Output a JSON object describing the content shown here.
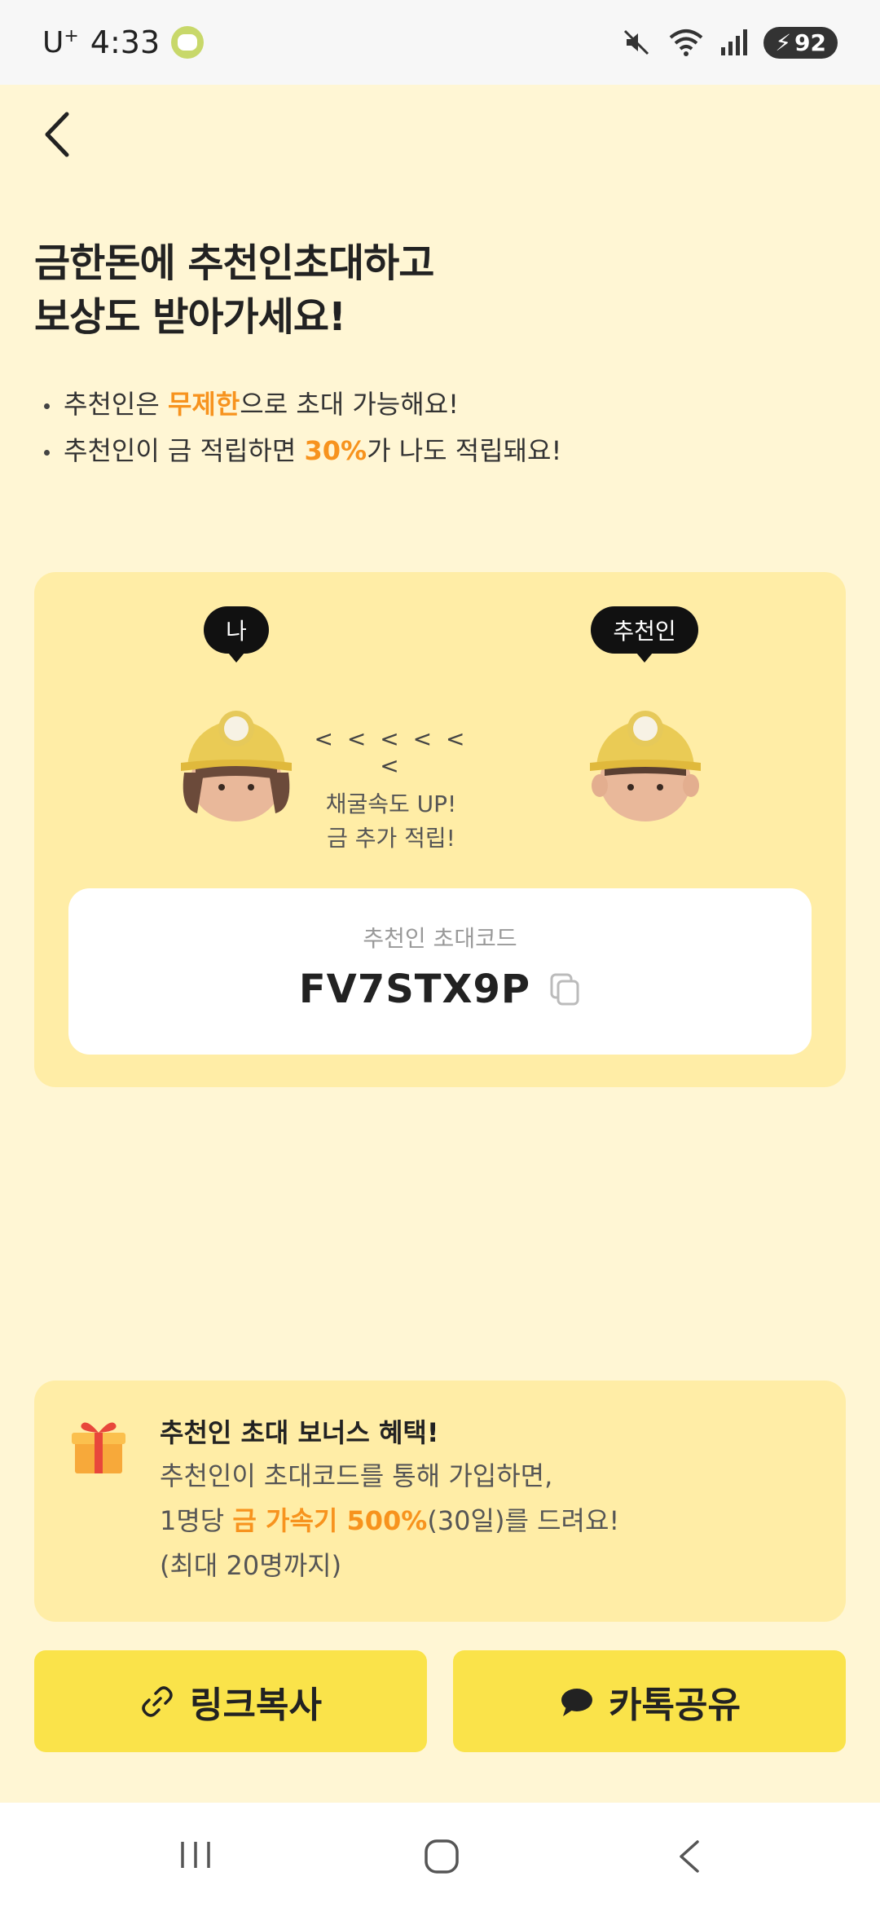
{
  "status_bar": {
    "carrier": "U",
    "carrier_sup": "+",
    "time": "4:33",
    "battery": "92"
  },
  "header": {
    "title_line1": "금한돈에 추천인초대하고",
    "title_line2": "보상도 받아가세요!"
  },
  "bullets": [
    {
      "pre": "추천인은 ",
      "highlight": "무제한",
      "post": "으로 초대 가능해요!"
    },
    {
      "pre": "추천인이 금 적립하면 ",
      "highlight": "30%",
      "post": "가 나도 적립돼요!"
    }
  ],
  "invite_card": {
    "me_label": "나",
    "referrer_label": "추천인",
    "arrows": "< < < < < <",
    "middle_line1": "채굴속도 UP!",
    "middle_line2": "금 추가 적립!",
    "code_label": "추천인 초대코드",
    "code_value": "FV7STX9P"
  },
  "bonus": {
    "title": "추천인 초대 보너스 혜택!",
    "line1": "추천인이 초대코드를 통해 가입하면,",
    "line2_pre": "1명당 ",
    "line2_highlight": "금 가속기 500%",
    "line2_post": "(30일)를 드려요!",
    "line3": "(최대 20명까지)"
  },
  "buttons": {
    "copy_link": "링크복사",
    "kakao_share": "카톡공유"
  },
  "colors": {
    "background": "#FFF6D4",
    "card": "#FFEDA6",
    "accent": "#F7931E",
    "button": "#FAE34A"
  },
  "icons": [
    "back-chevron-icon",
    "link-icon",
    "chat-bubble-icon",
    "copy-icon",
    "gift-icon",
    "mute-icon",
    "wifi-icon",
    "signal-icon",
    "battery-icon"
  ]
}
